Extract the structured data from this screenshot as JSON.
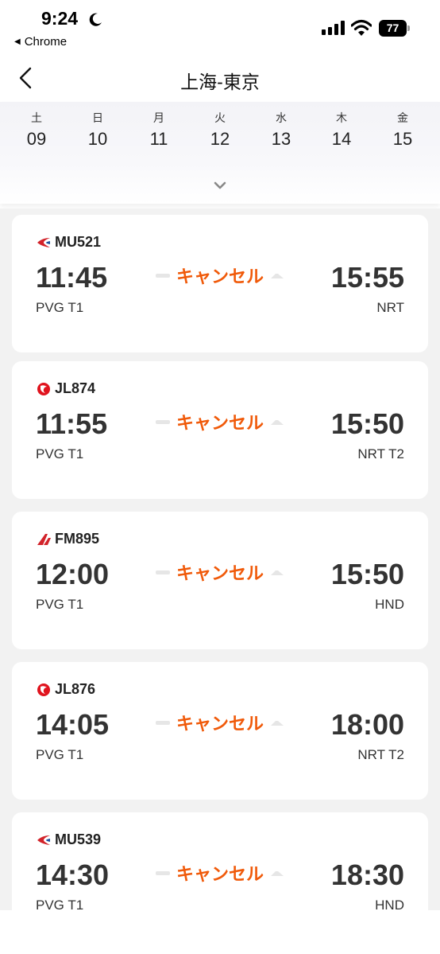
{
  "status_bar": {
    "time": "9:24",
    "back_app": "Chrome",
    "battery": "77"
  },
  "header": {
    "title": "上海-東京"
  },
  "dates": [
    {
      "dow": "土",
      "day": "09"
    },
    {
      "dow": "日",
      "day": "10"
    },
    {
      "dow": "月",
      "day": "11"
    },
    {
      "dow": "火",
      "day": "12"
    },
    {
      "dow": "水",
      "day": "13"
    },
    {
      "dow": "木",
      "day": "14"
    },
    {
      "dow": "金",
      "day": "15"
    }
  ],
  "flights": [
    {
      "airline": "china-eastern",
      "flight_no": "MU521",
      "dep_time": "11:45",
      "dep_term": "PVG T1",
      "status": "キャンセル",
      "arr_time": "15:55",
      "arr_term": "NRT"
    },
    {
      "airline": "jal",
      "flight_no": "JL874",
      "dep_time": "11:55",
      "dep_term": "PVG T1",
      "status": "キャンセル",
      "arr_time": "15:50",
      "arr_term": "NRT T2"
    },
    {
      "airline": "shanghai-airlines",
      "flight_no": "FM895",
      "dep_time": "12:00",
      "dep_term": "PVG T1",
      "status": "キャンセル",
      "arr_time": "15:50",
      "arr_term": "HND"
    },
    {
      "airline": "jal",
      "flight_no": "JL876",
      "dep_time": "14:05",
      "dep_term": "PVG T1",
      "status": "キャンセル",
      "arr_time": "18:00",
      "arr_term": "NRT T2"
    },
    {
      "airline": "china-eastern",
      "flight_no": "MU539",
      "dep_time": "14:30",
      "dep_term": "PVG T1",
      "status": "キャンセル",
      "arr_time": "18:30",
      "arr_term": "HND"
    }
  ],
  "colors": {
    "status_cancel": "#f05a0a",
    "list_background": "#f2f2f2",
    "china_eastern_red": "#d2232a",
    "china_eastern_blue": "#1a4f9c",
    "jal_red": "#e0141e"
  }
}
